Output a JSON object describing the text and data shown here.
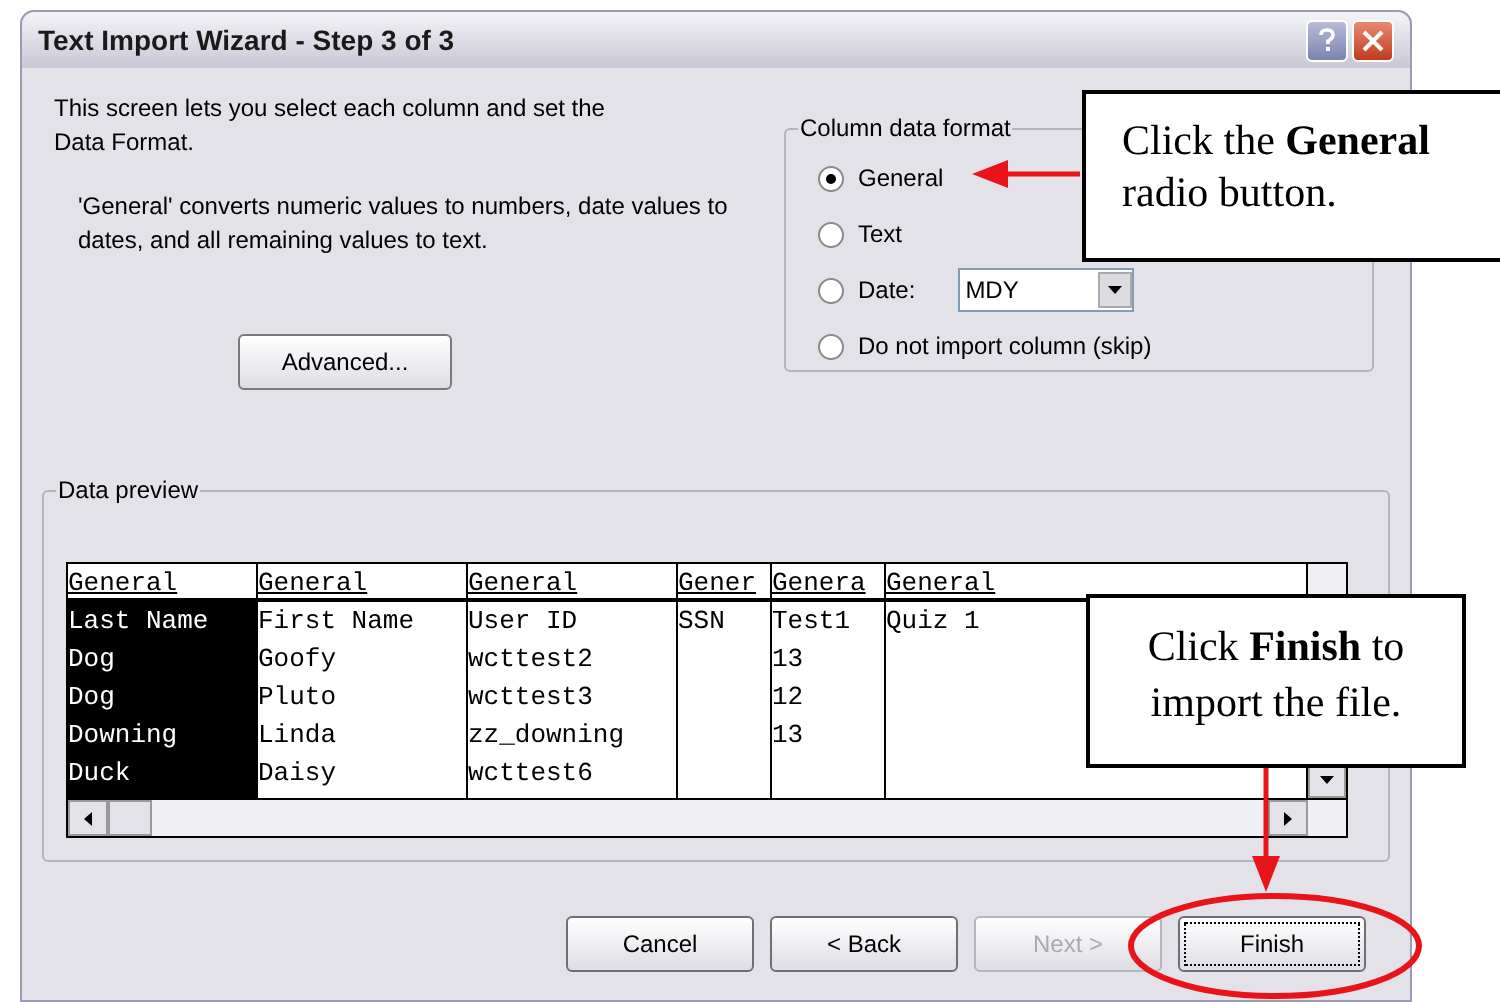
{
  "window": {
    "title": "Text Import Wizard - Step 3 of 3"
  },
  "intro": [
    "This screen lets you select each column and set the Data Format.",
    "'General' converts numeric values to numbers, date values to dates, and all remaining values to text."
  ],
  "column_data_format": {
    "title": "Column data format",
    "options": [
      {
        "label": "General",
        "selected": true
      },
      {
        "label": "Text",
        "selected": false
      },
      {
        "label": "Date:",
        "selected": false,
        "dropdown": "MDY"
      },
      {
        "label": "Do not import column (skip)",
        "selected": false
      }
    ]
  },
  "advanced_button": "Advanced...",
  "data_preview": {
    "title": "Data preview",
    "columns": [
      {
        "header": "General",
        "selected": true,
        "cells": [
          "Last Name",
          "Dog",
          "Dog",
          "Downing",
          "Duck"
        ]
      },
      {
        "header": "General",
        "selected": false,
        "cells": [
          "First Name",
          "Goofy",
          "Pluto",
          "Linda",
          "Daisy"
        ]
      },
      {
        "header": "General",
        "selected": false,
        "cells": [
          "User ID",
          "wcttest2",
          "wcttest3",
          "zz_downing",
          "wcttest6"
        ]
      },
      {
        "header": "Gener",
        "selected": false,
        "cells": [
          "SSN",
          "",
          "",
          "",
          ""
        ]
      },
      {
        "header": "Genera",
        "selected": false,
        "cells": [
          "Test1",
          "13",
          "12",
          "13",
          ""
        ]
      },
      {
        "header": "General",
        "selected": false,
        "cells": [
          "Quiz 1",
          "",
          "",
          "",
          ""
        ]
      }
    ]
  },
  "buttons": [
    {
      "label": "Cancel",
      "disabled": false,
      "focused": false
    },
    {
      "label": "< Back",
      "disabled": false,
      "focused": false
    },
    {
      "label": "Next >",
      "disabled": true,
      "focused": false
    },
    {
      "label": "Finish",
      "disabled": false,
      "focused": true
    }
  ],
  "callouts": [
    {
      "text": "Click the **General** radio button."
    },
    {
      "text": "Click **Finish** to import the file."
    }
  ]
}
